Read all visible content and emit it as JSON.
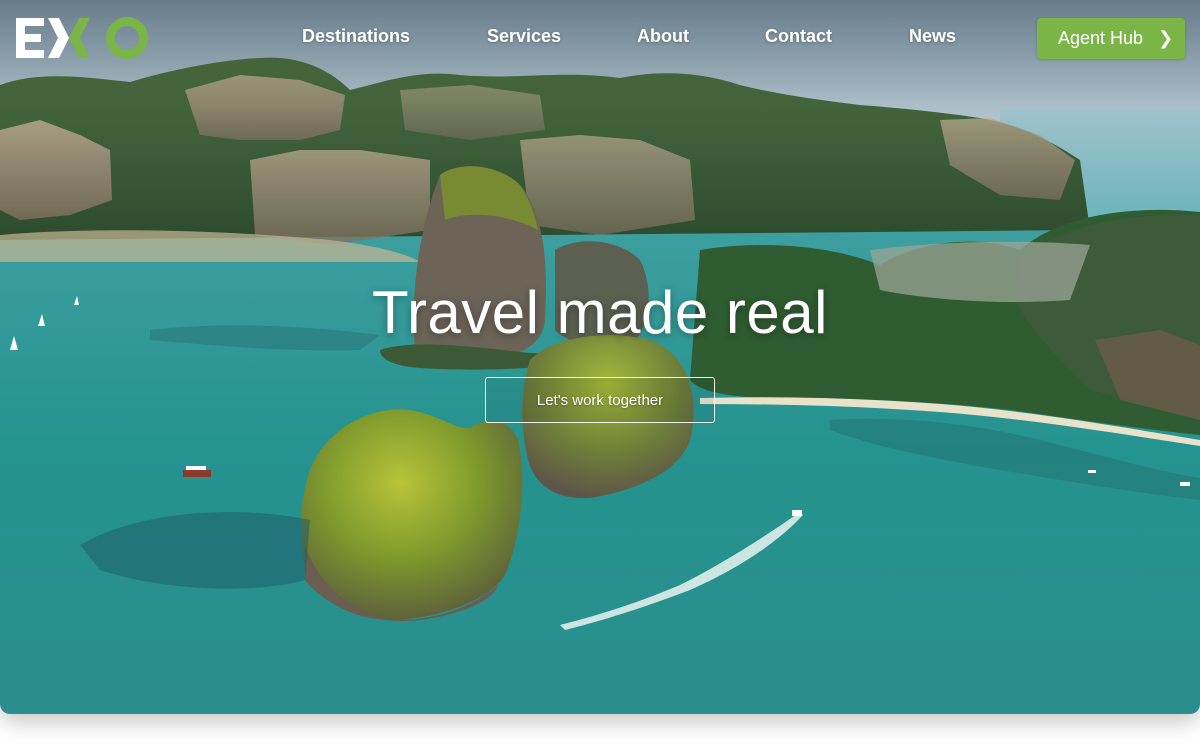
{
  "brand": {
    "logo_text": "EXO",
    "logo_color_white": "#ffffff",
    "logo_color_green": "#7bb548"
  },
  "nav": {
    "items": [
      {
        "label": "Destinations"
      },
      {
        "label": "Services"
      },
      {
        "label": "About"
      },
      {
        "label": "Contact"
      },
      {
        "label": "News"
      }
    ],
    "agent_hub": {
      "label": "Agent Hub",
      "icon": "chevron-right-icon",
      "chevron_glyph": "❯",
      "color": "#7bb548"
    }
  },
  "hero": {
    "title": "Travel made real",
    "cta_label": "Let's work together",
    "image": "aerial view of limestone islands, turquoise sea, beaches and boats"
  }
}
